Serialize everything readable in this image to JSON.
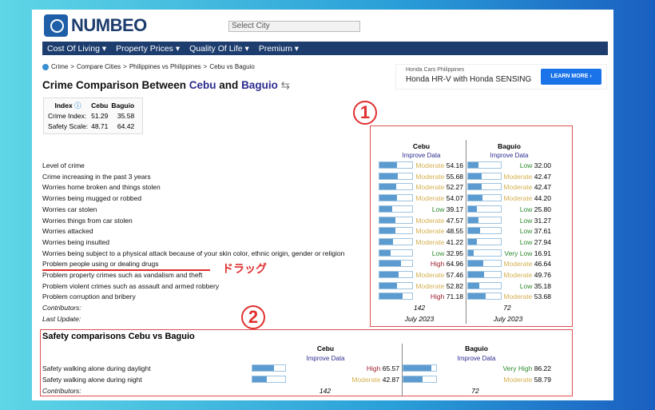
{
  "logo": "NUMBEO",
  "search_placeholder": "Select City",
  "nav": [
    "Cost Of Living ▾",
    "Property Prices ▾",
    "Quality Of Life ▾",
    "Premium ▾"
  ],
  "breadcrumb": [
    "Crime",
    ">",
    "Compare Cities",
    ">",
    "Philippines vs Philippines",
    ">",
    "Cebu vs Baguio"
  ],
  "title": {
    "pre": "Crime Comparison Between ",
    "city1": "Cebu",
    "mid": " and ",
    "city2": "Baguio",
    "swap": "⇆"
  },
  "index_table": {
    "headers": [
      "Index",
      "Cebu",
      "Baguio"
    ],
    "rows": [
      [
        "Crime Index:",
        "51.29",
        "35.58"
      ],
      [
        "Safety Scale:",
        "48.71",
        "64.42"
      ]
    ]
  },
  "ad": {
    "advertiser": "Honda Cars Philippines",
    "message": "Honda HR-V with Honda SENSING",
    "cta": "LEARN MORE ›"
  },
  "cities": [
    "Cebu",
    "Baguio"
  ],
  "improve": "Improve Data",
  "colors": {
    "Low": "#2e8b2e",
    "Very Low": "#2e8b2e",
    "Moderate": "#d4b050",
    "High": "#a02030",
    "Very High": "#2e8b2e"
  },
  "crime_rows": [
    [
      "Level of crime",
      "Moderate",
      "54.16",
      "Low",
      "32.00"
    ],
    [
      "Crime increasing in the past 3 years",
      "Moderate",
      "55.68",
      "Moderate",
      "42.47"
    ],
    [
      "Worries home broken and things stolen",
      "Moderate",
      "52.27",
      "Moderate",
      "42.47"
    ],
    [
      "Worries being mugged or robbed",
      "Moderate",
      "54.07",
      "Moderate",
      "44.20"
    ],
    [
      "Worries car stolen",
      "Low",
      "39.17",
      "Low",
      "25.80"
    ],
    [
      "Worries things from car stolen",
      "Moderate",
      "47.57",
      "Low",
      "31.27"
    ],
    [
      "Worries attacked",
      "Moderate",
      "48.55",
      "Low",
      "37.61"
    ],
    [
      "Worries being insulted",
      "Moderate",
      "41.22",
      "Low",
      "27.94"
    ],
    [
      "Worries being subject to a physical attack because of your skin color, ethnic origin, gender or religion",
      "Low",
      "32.95",
      "Very Low",
      "16.91"
    ],
    [
      "Problem people using or dealing drugs",
      "High",
      "64.96",
      "Moderate",
      "46.64"
    ],
    [
      "Problem property crimes such as vandalism and theft",
      "Moderate",
      "57.46",
      "Moderate",
      "49.76"
    ],
    [
      "Problem violent crimes such as assault and armed robbery",
      "Moderate",
      "52.82",
      "Low",
      "35.18"
    ],
    [
      "Problem corruption and bribery",
      "High",
      "71.18",
      "Moderate",
      "53.68"
    ]
  ],
  "contributors": {
    "label": "Contributors:",
    "cebu": "142",
    "baguio": "72"
  },
  "last_update": {
    "label": "Last Update:",
    "cebu": "July 2023",
    "baguio": "July 2023"
  },
  "safety": {
    "title": "Safety comparisons Cebu vs Baguio",
    "rows": [
      [
        "Safety walking alone during daylight",
        "High",
        "65.57",
        "Very High",
        "86.22"
      ],
      [
        "Safety walking alone during night",
        "Moderate",
        "42.87",
        "Moderate",
        "58.79"
      ]
    ]
  },
  "annotations": {
    "one": "1",
    "two": "2",
    "drag": "ドラッグ"
  }
}
